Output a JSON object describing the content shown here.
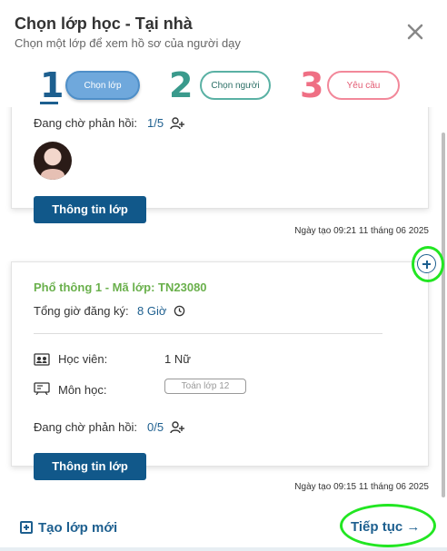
{
  "header": {
    "title": "Chọn lớp học - Tại nhà",
    "subtitle": "Chọn một lớp để xem hồ sơ của người dạy",
    "close_icon": "close-icon"
  },
  "steps": [
    {
      "number": "1",
      "label": "Chọn lớp",
      "active": true,
      "color": "#1d5f8f"
    },
    {
      "number": "2",
      "label": "Chọn người",
      "active": false,
      "color": "#3a9a8c"
    },
    {
      "number": "3",
      "label": "Yêu cầu",
      "active": false,
      "color": "#ef6f84"
    }
  ],
  "cards": [
    {
      "pending_label": "Đang chờ phản hồi:",
      "pending_value": "1/5",
      "info_button": "Thông tin lớp",
      "created": "Ngày tạo 09:21 11 tháng 06 2025"
    },
    {
      "class_title": "Phổ thông 1 - Mã lớp: TN23080",
      "hours_label": "Tổng giờ đăng ký:",
      "hours_value": "8 Giờ",
      "student_label": "Học viên:",
      "student_value": "1 Nữ",
      "subject_label": "Môn học:",
      "subject_value": "Toán lớp 12",
      "pending_label": "Đang chờ phản hồi:",
      "pending_value": "0/5",
      "info_button": "Thông tin lớp",
      "created": "Ngày tạo 09:15 11 tháng 06 2025"
    }
  ],
  "footer": {
    "new_class": "Tạo lớp mới",
    "continue": "Tiếp tục →"
  },
  "colors": {
    "primary": "#11588a",
    "class_title": "#6ab04c",
    "highlight": "#22e622"
  }
}
